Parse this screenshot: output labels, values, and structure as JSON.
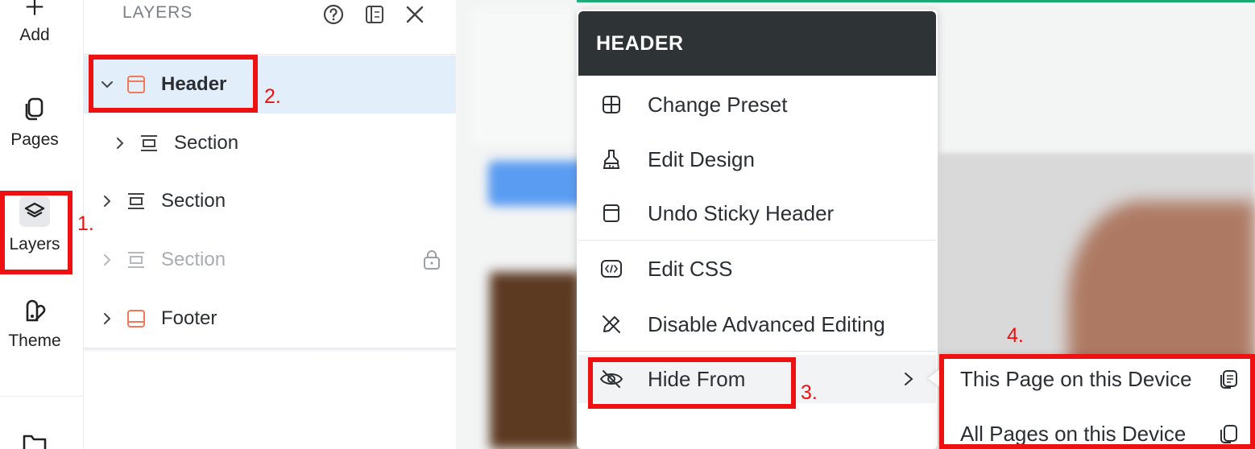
{
  "rail": {
    "items": [
      {
        "label": "Add",
        "icon": "plus-icon"
      },
      {
        "label": "Pages",
        "icon": "pages-icon"
      },
      {
        "label": "Layers",
        "icon": "layers-icon"
      },
      {
        "label": "Theme",
        "icon": "theme-icon"
      }
    ]
  },
  "panel": {
    "title": "LAYERS",
    "tools": [
      "help-icon",
      "dock-icon",
      "close-icon"
    ],
    "layers": [
      {
        "label": "Header",
        "icon": "header-icon",
        "state": "expanded",
        "selected": true
      },
      {
        "label": "Section",
        "icon": "section-icon",
        "state": "collapsed",
        "nested": true
      },
      {
        "label": "Section",
        "icon": "section-icon",
        "state": "collapsed"
      },
      {
        "label": "Section",
        "icon": "section-icon",
        "state": "collapsed",
        "locked": true
      },
      {
        "label": "Footer",
        "icon": "footer-icon",
        "state": "collapsed"
      }
    ]
  },
  "menu": {
    "title": "HEADER",
    "items": [
      {
        "label": "Change Preset",
        "icon": "grid-icon"
      },
      {
        "label": "Edit Design",
        "icon": "brush-icon"
      },
      {
        "label": "Undo Sticky Header",
        "icon": "sticky-icon"
      },
      {
        "label": "Edit CSS",
        "icon": "code-icon"
      },
      {
        "label": "Disable Advanced Editing",
        "icon": "pen-off-icon"
      },
      {
        "label": "Hide From",
        "icon": "eye-off-icon",
        "has_submenu": true
      }
    ]
  },
  "submenu": {
    "items": [
      {
        "label": "This Page on this Device",
        "icon": "page-copy-icon"
      },
      {
        "label": "All Pages on this Device",
        "icon": "pages-copy-icon"
      }
    ]
  },
  "annotations": [
    "1.",
    "2.",
    "3.",
    "4."
  ],
  "colors": {
    "annotation": "#ee1111",
    "selection": "#e3eefb",
    "menu_header": "#2e3336",
    "accent_orange": "#f07a57"
  }
}
